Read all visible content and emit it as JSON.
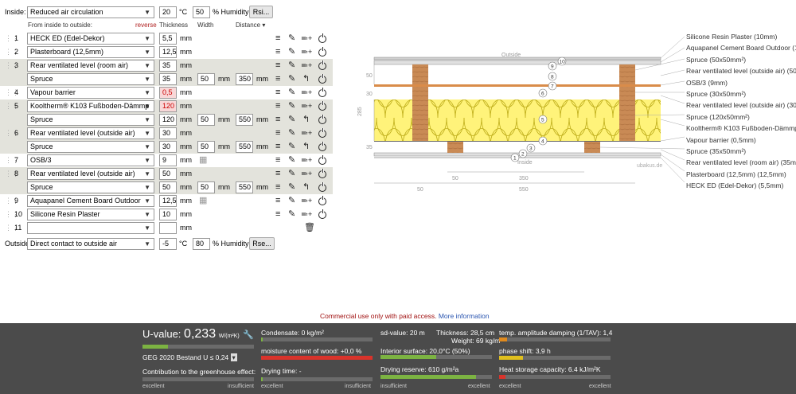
{
  "inside": {
    "label": "Inside:",
    "climate": "Reduced air circulation",
    "temp": "20",
    "temp_unit": "°C",
    "humidity": "50",
    "humidity_unit": "% Humidity",
    "rsi_button": "Rsi..."
  },
  "headers": {
    "from": "From inside to outside:",
    "reverse": "reverse",
    "thickness": "Thickness",
    "width": "Width",
    "distance": "Distance ▾"
  },
  "layers": [
    {
      "num": "1",
      "name": "HECK ED (Edel-Dekor)",
      "thick": "5,5",
      "unit": "mm"
    },
    {
      "num": "2",
      "name": "Plasterboard (12,5mm)",
      "thick": "12,5",
      "unit": "mm"
    },
    {
      "num": "3",
      "name": "Rear ventilated level (room air)",
      "thick": "35",
      "unit": "mm",
      "sub": {
        "name": "Spruce",
        "thick": "35",
        "width": "50",
        "dist": "350"
      }
    },
    {
      "num": "4",
      "name": "Vapour barrier",
      "thick": "0,5",
      "unit": "mm"
    },
    {
      "num": "5",
      "name": "Kooltherm® K103 Fußboden-Dämmp",
      "thick": "120",
      "unit": "mm",
      "sub": {
        "name": "Spruce",
        "thick": "120",
        "width": "50",
        "dist": "550"
      }
    },
    {
      "num": "6",
      "name": "Rear ventilated level (outside air)",
      "thick": "30",
      "unit": "mm",
      "sub": {
        "name": "Spruce",
        "thick": "30",
        "width": "50",
        "dist": "550"
      }
    },
    {
      "num": "7",
      "name": "OSB/3",
      "thick": "9",
      "unit": "mm"
    },
    {
      "num": "8",
      "name": "Rear ventilated level (outside air)",
      "thick": "50",
      "unit": "mm",
      "sub": {
        "name": "Spruce",
        "thick": "50",
        "width": "50",
        "dist": "550"
      }
    },
    {
      "num": "9",
      "name": "Aquapanel Cement Board Outdoor",
      "thick": "12,5",
      "unit": "mm"
    },
    {
      "num": "10",
      "name": "Silicone Resin Plaster",
      "thick": "10",
      "unit": "mm"
    },
    {
      "num": "11",
      "name": "",
      "thick": "",
      "unit": "mm"
    }
  ],
  "mm": "mm",
  "outside": {
    "label": "Outside",
    "climate": "Direct contact to outside air",
    "temp": "-5",
    "temp_unit": "°C",
    "humidity": "80",
    "humidity_unit": "% Humidity",
    "rse_button": "Rse..."
  },
  "diagram": {
    "outside": "Outside",
    "inside": "Inside",
    "watermark": "ubakus.de",
    "dims": {
      "d50": "50",
      "d30": "30",
      "d285": "285",
      "d35": "35",
      "b50": "50",
      "b350": "350",
      "b550": "550",
      "b50b": "50"
    },
    "legend": [
      "Silicone Resin Plaster (10mm)",
      "Aquapanel Cement Board Outdoor (12",
      "Spruce (50x50mm²)",
      "Rear ventilated level (outside air) (50m",
      "OSB/3 (9mm)",
      "Spruce (30x50mm²)",
      "Rear ventilated level (outside air) (30m",
      "Spruce (120x50mm²)",
      "Kooltherm® K103 Fußboden-Dämmpla",
      "Vapour barrier (0,5mm)",
      "Spruce (35x50mm²)",
      "Rear ventilated level (room air) (35mm",
      "Plasterboard (12,5mm) (12,5mm)",
      "HECK ED (Edel-Dekor) (5,5mm)"
    ],
    "circles": [
      "1",
      "2",
      "3",
      "4",
      "5",
      "6",
      "7",
      "8",
      "9",
      "10"
    ]
  },
  "commercial": {
    "text": "Commercial use only with paid access.",
    "link": "More information"
  },
  "results": {
    "u_label": "U-value:",
    "u_value": "0,233",
    "u_unit": "W/(m²K)",
    "u_fill": 0.23,
    "geg": "GEG 2020 Bestand U ≤ 0,24",
    "greenhouse": "Contribution to the greenhouse effect:",
    "scale_good": "excellent",
    "scale_bad": "insufficient",
    "condensate": "Condensate: 0 kg/m²",
    "wood": "moisture content of wood: +0,0 %",
    "drying": "Drying time: -",
    "sd": "sd-value: 20 m",
    "thickness": "Thickness: 28,5 cm",
    "weight": "Weight: 69 kg/m²",
    "surface": "Interior surface: 20,0°C (50%)",
    "reserve": "Drying reserve: 610 g/m²a",
    "tav": "temp. amplitude damping (1/TAV): 1,4",
    "phase": "phase shift: 3,9 h",
    "heat": "Heat storage capacity: 6.4 kJ/m²K"
  },
  "colors": {
    "row_alt": "#e3e3dc",
    "footer": "#4b4b4b",
    "bar_green": "#7cb342",
    "bar_orange": "#e08a1e",
    "bar_red": "#d9332b",
    "insulation": "#fff37a",
    "wood": "#c98a55"
  }
}
